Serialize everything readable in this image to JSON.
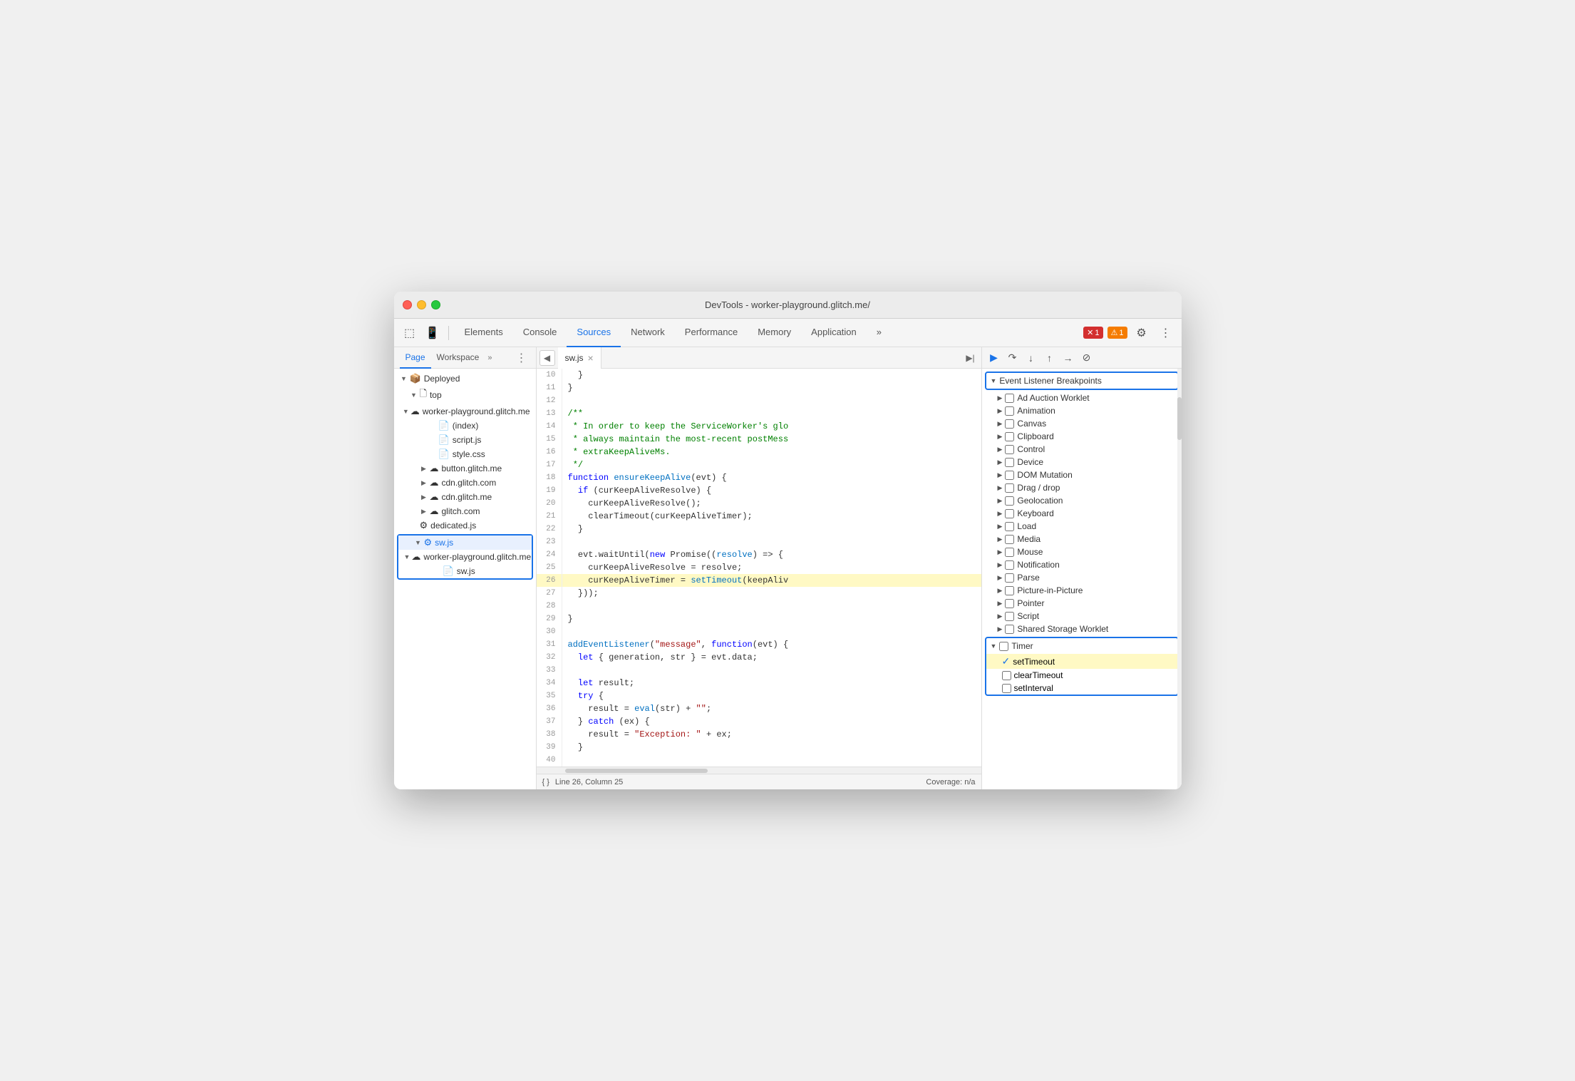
{
  "window": {
    "title": "DevTools - worker-playground.glitch.me/"
  },
  "toolbar": {
    "tabs": [
      {
        "label": "Elements",
        "active": false
      },
      {
        "label": "Console",
        "active": false
      },
      {
        "label": "Sources",
        "active": true
      },
      {
        "label": "Network",
        "active": false
      },
      {
        "label": "Performance",
        "active": false
      },
      {
        "label": "Memory",
        "active": false
      },
      {
        "label": "Application",
        "active": false
      }
    ],
    "more_label": "»",
    "error_count": "1",
    "warn_count": "1",
    "settings_label": "⚙"
  },
  "left_panel": {
    "tabs": [
      {
        "label": "Page",
        "active": true
      },
      {
        "label": "Workspace",
        "active": false
      }
    ],
    "more": "»",
    "tree": [
      {
        "id": "deployed",
        "label": "Deployed",
        "indent": 0,
        "type": "folder",
        "open": true
      },
      {
        "id": "top",
        "label": "top",
        "indent": 1,
        "type": "folder-simple",
        "open": true
      },
      {
        "id": "worker-playground",
        "label": "worker-playground.glitch.me",
        "indent": 2,
        "type": "folder-cloud",
        "open": true
      },
      {
        "id": "index",
        "label": "(index)",
        "indent": 3,
        "type": "file"
      },
      {
        "id": "script-js",
        "label": "script.js",
        "indent": 3,
        "type": "file-orange"
      },
      {
        "id": "style-css",
        "label": "style.css",
        "indent": 3,
        "type": "file-purple"
      },
      {
        "id": "button-glitch",
        "label": "button.glitch.me",
        "indent": 2,
        "type": "folder-cloud-collapsed"
      },
      {
        "id": "cdn-glitch-com",
        "label": "cdn.glitch.com",
        "indent": 2,
        "type": "folder-cloud-collapsed"
      },
      {
        "id": "cdn-glitch-me",
        "label": "cdn.glitch.me",
        "indent": 2,
        "type": "folder-cloud-collapsed"
      },
      {
        "id": "glitch-com",
        "label": "glitch.com",
        "indent": 2,
        "type": "folder-cloud-collapsed"
      },
      {
        "id": "dedicated-js",
        "label": "dedicated.js",
        "indent": 2,
        "type": "file-gear"
      },
      {
        "id": "sw-js-parent",
        "label": "sw.js",
        "indent": 1,
        "type": "folder-gear",
        "open": true,
        "selected": true
      },
      {
        "id": "worker-playground-sw",
        "label": "worker-playground.glitch.me",
        "indent": 2,
        "type": "folder-cloud",
        "open": true
      },
      {
        "id": "sw-js-child",
        "label": "sw.js",
        "indent": 3,
        "type": "file-orange",
        "selected": true
      }
    ]
  },
  "editor": {
    "tab_filename": "sw.js",
    "lines": [
      {
        "num": 10,
        "content": "  }",
        "highlight": false
      },
      {
        "num": 11,
        "content": "}",
        "highlight": false
      },
      {
        "num": 12,
        "content": "",
        "highlight": false
      },
      {
        "num": 13,
        "content": "/**",
        "highlight": false,
        "type": "comment"
      },
      {
        "num": 14,
        "content": " * In order to keep the ServiceWorker's glo",
        "highlight": false,
        "type": "comment"
      },
      {
        "num": 15,
        "content": " * always maintain the most-recent postMess",
        "highlight": false,
        "type": "comment"
      },
      {
        "num": 16,
        "content": " * extraKeepAliveMs.",
        "highlight": false,
        "type": "comment"
      },
      {
        "num": 17,
        "content": " */",
        "highlight": false,
        "type": "comment"
      },
      {
        "num": 18,
        "content": "function ensureKeepAlive(evt) {",
        "highlight": false
      },
      {
        "num": 19,
        "content": "  if (curKeepAliveResolve) {",
        "highlight": false
      },
      {
        "num": 20,
        "content": "    curKeepAliveResolve();",
        "highlight": false
      },
      {
        "num": 21,
        "content": "    clearTimeout(curKeepAliveTimer);",
        "highlight": false
      },
      {
        "num": 22,
        "content": "  }",
        "highlight": false
      },
      {
        "num": 23,
        "content": "",
        "highlight": false
      },
      {
        "num": 24,
        "content": "  evt.waitUntil(new Promise((resolve) => {",
        "highlight": false
      },
      {
        "num": 25,
        "content": "    curKeepAliveResolve = resolve;",
        "highlight": false
      },
      {
        "num": 26,
        "content": "    curKeepAliveTimer = setTimeout(keepAliv",
        "highlight": true
      },
      {
        "num": 27,
        "content": "  }));",
        "highlight": false
      },
      {
        "num": 28,
        "content": "",
        "highlight": false
      },
      {
        "num": 29,
        "content": "}",
        "highlight": false
      },
      {
        "num": 30,
        "content": "",
        "highlight": false
      },
      {
        "num": 31,
        "content": "addEventListener(\"message\", function(evt) {",
        "highlight": false
      },
      {
        "num": 32,
        "content": "  let { generation, str } = evt.data;",
        "highlight": false
      },
      {
        "num": 33,
        "content": "",
        "highlight": false
      },
      {
        "num": 34,
        "content": "  let result;",
        "highlight": false
      },
      {
        "num": 35,
        "content": "  try {",
        "highlight": false
      },
      {
        "num": 36,
        "content": "    result = eval(str) + \"\";",
        "highlight": false
      },
      {
        "num": 37,
        "content": "  } catch (ex) {",
        "highlight": false
      },
      {
        "num": 38,
        "content": "    result = \"Exception: \" + ex;",
        "highlight": false
      },
      {
        "num": 39,
        "content": "  }",
        "highlight": false
      },
      {
        "num": 40,
        "content": "",
        "highlight": false
      }
    ],
    "status": {
      "format_label": "{ }",
      "position": "Line 26, Column 25",
      "coverage": "Coverage: n/a"
    }
  },
  "breakpoints": {
    "section_title": "Event Listener Breakpoints",
    "items": [
      {
        "label": "Ad Auction Worklet",
        "checked": false,
        "open": false
      },
      {
        "label": "Animation",
        "checked": false,
        "open": false
      },
      {
        "label": "Canvas",
        "checked": false,
        "open": false
      },
      {
        "label": "Clipboard",
        "checked": false,
        "open": false
      },
      {
        "label": "Control",
        "checked": false,
        "open": false
      },
      {
        "label": "Device",
        "checked": false,
        "open": false
      },
      {
        "label": "DOM Mutation",
        "checked": false,
        "open": false
      },
      {
        "label": "Drag / drop",
        "checked": false,
        "open": false
      },
      {
        "label": "Geolocation",
        "checked": false,
        "open": false
      },
      {
        "label": "Keyboard",
        "checked": false,
        "open": false
      },
      {
        "label": "Load",
        "checked": false,
        "open": false
      },
      {
        "label": "Media",
        "checked": false,
        "open": false
      },
      {
        "label": "Mouse",
        "checked": false,
        "open": false
      },
      {
        "label": "Notification",
        "checked": false,
        "open": false
      },
      {
        "label": "Parse",
        "checked": false,
        "open": false
      },
      {
        "label": "Picture-in-Picture",
        "checked": false,
        "open": false
      },
      {
        "label": "Pointer",
        "checked": false,
        "open": false
      },
      {
        "label": "Script",
        "checked": false,
        "open": false
      },
      {
        "label": "Shared Storage Worklet",
        "checked": false,
        "open": false
      }
    ],
    "timer_section": {
      "label": "Timer",
      "open": true,
      "sub_items": [
        {
          "label": "setTimeout",
          "checked": true,
          "highlighted": true
        },
        {
          "label": "clearTimeout",
          "checked": false
        },
        {
          "label": "setInterval",
          "checked": false
        }
      ]
    }
  }
}
